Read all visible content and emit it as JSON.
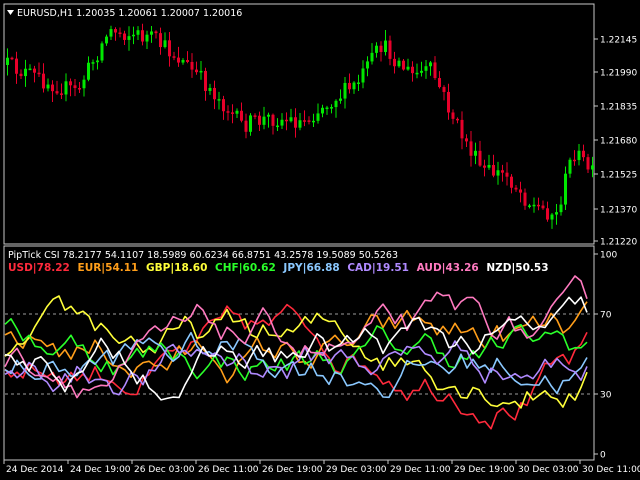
{
  "main_chart": {
    "title": "EURUSD,H1  1.20035 1.20061 1.20007 1.20016",
    "price_ticks": [
      "1.22145",
      "1.21990",
      "1.21835",
      "1.21680",
      "1.21525",
      "1.21370",
      "1.21220"
    ],
    "bull_color": "#00e800",
    "bear_color": "#e8002a"
  },
  "indicator": {
    "header": "PipTick CSI 78.2177 54.1107 18.5989 60.6234 66.8751 43.2578 19.5089 50.5263",
    "legend": [
      {
        "label": "USD|78.22",
        "color": "#ff2a3c"
      },
      {
        "label": "EUR|54.11",
        "color": "#ff9e1a"
      },
      {
        "label": "GBP|18.60",
        "color": "#ffff3a"
      },
      {
        "label": "CHF|60.62",
        "color": "#2aff2a"
      },
      {
        "label": "JPY|66.88",
        "color": "#8ac8ff"
      },
      {
        "label": "CAD|19.51",
        "color": "#b08aff"
      },
      {
        "label": "AUD|43.26",
        "color": "#ff7ac0"
      },
      {
        "label": "NZD|50.53",
        "color": "#ffffff"
      }
    ],
    "scale_ticks": [
      "100",
      "70",
      "30",
      "0"
    ],
    "levels": [
      70,
      30
    ]
  },
  "time_axis": [
    "24 Dec 2014",
    "24 Dec 19:00",
    "26 Dec 03:00",
    "26 Dec 11:00",
    "26 Dec 19:00",
    "29 Dec 03:00",
    "29 Dec 11:00",
    "29 Dec 19:00",
    "30 Dec 03:00",
    "30 Dec 11:00"
  ]
}
